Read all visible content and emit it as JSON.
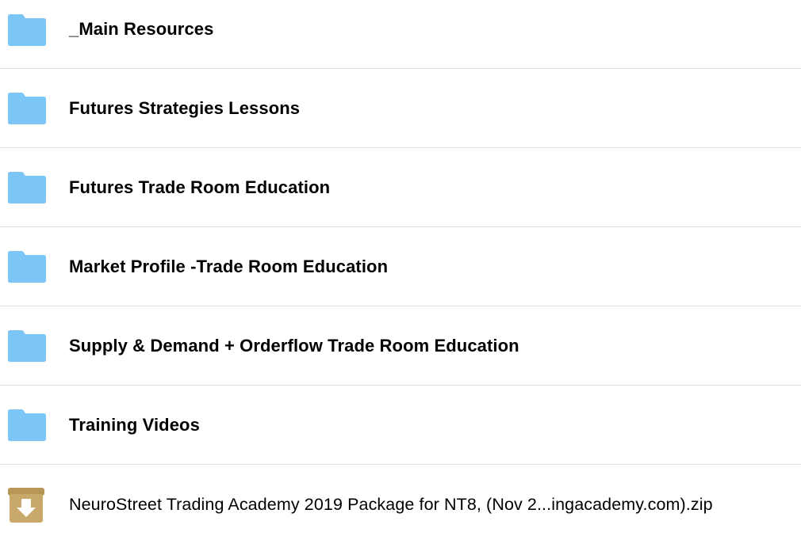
{
  "items": [
    {
      "type": "folder",
      "name": "_Main Resources",
      "icon": "folder-icon"
    },
    {
      "type": "folder",
      "name": "Futures Strategies Lessons",
      "icon": "folder-icon"
    },
    {
      "type": "folder",
      "name": "Futures Trade Room Education",
      "icon": "folder-icon"
    },
    {
      "type": "folder",
      "name": "Market Profile -Trade Room Education",
      "icon": "folder-icon"
    },
    {
      "type": "folder",
      "name": "Supply & Demand + Orderflow Trade Room Education",
      "icon": "folder-icon"
    },
    {
      "type": "folder",
      "name": "Training Videos",
      "icon": "folder-icon"
    },
    {
      "type": "archive",
      "name": "NeuroStreet Trading Academy 2019 Package for NT8, (Nov 2...ingacademy.com).zip",
      "icon": "archive-icon"
    }
  ],
  "colors": {
    "folder": "#7cc5f7",
    "folder_tab": "#6bb8ee",
    "archive": "#c9a96b",
    "archive_dark": "#b89655",
    "divider": "#e2e2e2"
  }
}
